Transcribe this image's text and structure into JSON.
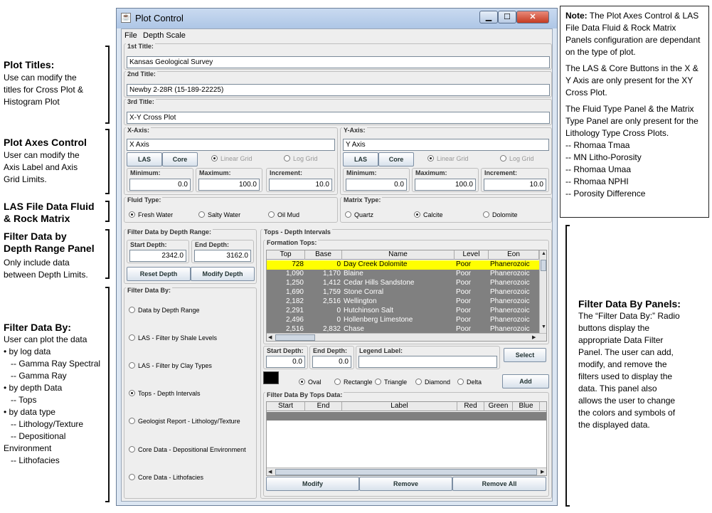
{
  "annotations": {
    "plot_titles": {
      "heading": "Plot Titles:",
      "lines": [
        "Use can modify the",
        "titles for Cross Plot &",
        "Histogram Plot"
      ]
    },
    "plot_axes": {
      "heading": "Plot Axes Control",
      "lines": [
        "User can modify the",
        "Axis Label and Axis",
        "Grid Limits."
      ]
    },
    "las_fluid": {
      "heading_lines": [
        "LAS File Data Fluid",
        "& Rock Matrix"
      ]
    },
    "depth_range": {
      "heading_lines": [
        "Filter Data by",
        "Depth Range Panel"
      ],
      "lines": [
        "Only include data",
        "between Depth Limits."
      ]
    },
    "filter_by": {
      "heading": "Filter Data By:",
      "lines": [
        "User can plot the data",
        "• by  log data",
        "   -- Gamma Ray Spectral",
        "   -- Gamma Ray",
        "• by depth Data",
        "   -- Tops",
        "• by data type",
        "   -- Lithology/Texture",
        "   -- Depositional",
        "Environment",
        "   -- Lithofacies"
      ]
    },
    "filter_panels": {
      "heading": "Filter Data By Panels:",
      "lines": [
        "The “Filter Data By:”  Radio",
        "buttons display the",
        "appropriate Data Filter",
        "Panel.  The user can add,",
        "modify, and remove the",
        "filters used to display the",
        "data.  This panel also",
        "allows the user to change",
        "the colors and symbols of",
        "the displayed data."
      ]
    }
  },
  "note": {
    "bold": "Note:",
    "p1": " The Plot Axes Control & LAS File Data Fluid & Rock Matrix Panels configuration  are dependant on the type of plot.",
    "p2": "The LAS & Core Buttons in the X & Y Axis are only  present for the XY Cross Plot.",
    "p3": "The Fluid Type Panel & the Matrix Type Panel are only present for the Lithology Type Cross Plots.",
    "items": [
      "-- Rhomaa Tmaa",
      "-- MN Litho-Porosity",
      "-- Rhomaa Umaa",
      "-- Rhomaa NPHI",
      "-- Porosity Difference"
    ]
  },
  "window": {
    "title": "Plot Control",
    "menu": [
      "File",
      "Depth Scale"
    ],
    "titles": {
      "t1_label": "1st Title:",
      "t1": "Kansas Geological Survey",
      "t2_label": "2nd Title:",
      "t2": "Newby 2-28R (15-189-22225)",
      "t3_label": "3rd Title:",
      "t3": "X-Y Cross Plot"
    },
    "x_axis": {
      "label": "X-Axis:",
      "value": "X Axis",
      "las": "LAS",
      "core": "Core",
      "linear": "Linear Grid",
      "log": "Log Grid",
      "min_label": "Minimum:",
      "min": "0.0",
      "max_label": "Maximum:",
      "max": "100.0",
      "inc_label": "Increment:",
      "inc": "10.0"
    },
    "y_axis": {
      "label": "Y-Axis:",
      "value": "Y Axis",
      "las": "LAS",
      "core": "Core",
      "linear": "Linear Grid",
      "log": "Log Grid",
      "min_label": "Minimum:",
      "min": "0.0",
      "max_label": "Maximum:",
      "max": "100.0",
      "inc_label": "Increment:",
      "inc": "10.0"
    },
    "fluid": {
      "label": "Fluid Type:",
      "options": [
        "Fresh Water",
        "Salty Water",
        "Oil Mud"
      ]
    },
    "matrix": {
      "label": "Matrix Type:",
      "options": [
        "Quartz",
        "Calcite",
        "Dolomite"
      ]
    },
    "depth_range": {
      "label": "Filter Data by Depth Range:",
      "start_label": "Start Depth:",
      "start": "2342.0",
      "end_label": "End Depth:",
      "end": "3162.0",
      "reset": "Reset Depth",
      "modify": "Modify Depth"
    },
    "filter_by": {
      "label": "Filter Data By:",
      "options": [
        "Data by Depth Range",
        "LAS - Filter by Shale Levels",
        "LAS - Filter by Clay Types",
        "Tops - Depth Intervals",
        "Geologist Report - Lithology/Texture",
        "Core Data - Depositional Environment",
        "Core Data - Lithofacies"
      ]
    },
    "tops": {
      "label": "Tops - Depth Intervals",
      "formation_label": "Formation Tops:",
      "columns": [
        "Top",
        "Base",
        "Name",
        "Level",
        "Eon"
      ],
      "rows": [
        [
          "728",
          "0",
          "Day Creek Dolomite",
          "Poor",
          "Phanerozoic"
        ],
        [
          "1,090",
          "1,170",
          "Blaine",
          "Poor",
          "Phanerozoic"
        ],
        [
          "1,250",
          "1,412",
          "Cedar Hills Sandstone",
          "Poor",
          "Phanerozoic"
        ],
        [
          "1,690",
          "1,759",
          "Stone Corral",
          "Poor",
          "Phanerozoic"
        ],
        [
          "2,182",
          "2,516",
          "Wellington",
          "Poor",
          "Phanerozoic"
        ],
        [
          "2,291",
          "0",
          "Hutchinson Salt",
          "Poor",
          "Phanerozoic"
        ],
        [
          "2,496",
          "0",
          "Hollenberg Limestone",
          "Poor",
          "Phanerozoic"
        ],
        [
          "2,516",
          "2,832",
          "Chase",
          "Poor",
          "Phanerozoic"
        ]
      ],
      "start_label": "Start Depth:",
      "start": "0.0",
      "end_label": "End Depth:",
      "end": "0.0",
      "legend_label": "Legend Label:",
      "legend": "",
      "select": "Select",
      "add": "Add",
      "symbols": [
        "Oval",
        "Rectangle",
        "Triangle",
        "Diamond",
        "Delta"
      ],
      "swatch_color": "#000000",
      "filter_tops_label": "Filter Data By Tops Data:",
      "filter_columns": [
        "Start",
        "End",
        "Label",
        "Red",
        "Green",
        "Blue"
      ],
      "modify": "Modify",
      "remove": "Remove",
      "remove_all": "Remove All"
    }
  }
}
